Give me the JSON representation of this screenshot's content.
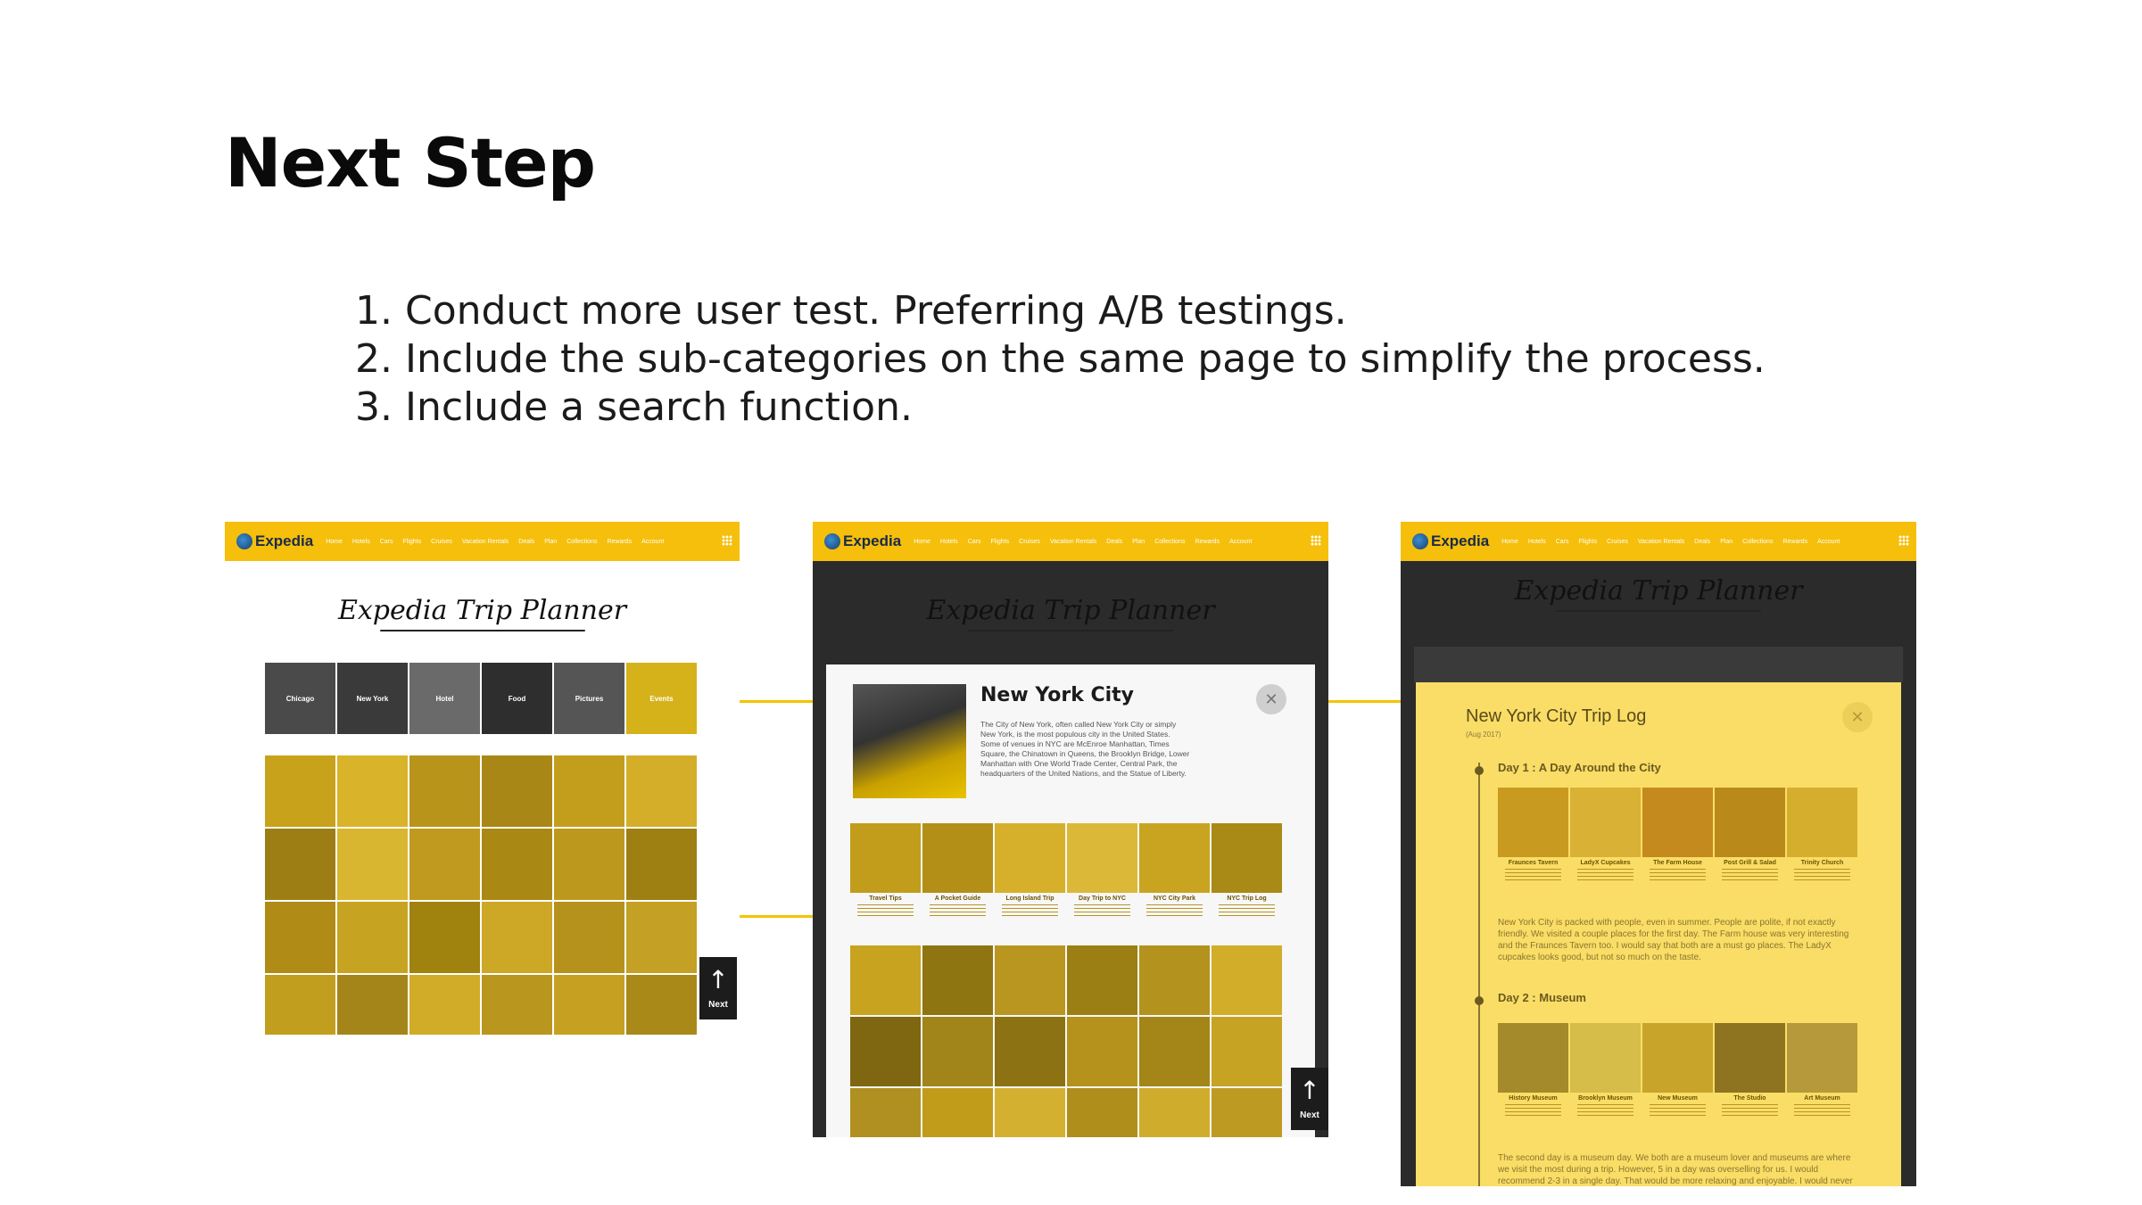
{
  "slide": {
    "title": "Next Step",
    "steps": [
      "1. Conduct more user test. Preferring A/B testings.",
      "2. Include the sub-categories on the same page to simplify the process.",
      "3. Include a search function."
    ]
  },
  "header": {
    "brand": "Expedia",
    "nav": [
      "Home",
      "Hotels",
      "Cars",
      "Flights",
      "Cruises",
      "Vacation Rentals",
      "Deals",
      "Plan",
      "Collections",
      "Rewards",
      "Account"
    ]
  },
  "planner_title": "Expedia Trip Planner",
  "categories": [
    "Chicago",
    "New York",
    "Hotel",
    "Food",
    "Pictures",
    "Events"
  ],
  "scroll_button": {
    "label": "Next"
  },
  "city_modal": {
    "title": "New York City",
    "description": "The City of New York, often called New York City or simply New York, is the most populous city in the United States. Some of venues in NYC are McEnroe Manhattan, Times Square, the Chinatown in Queens, the Brooklyn Bridge, Lower Manhattan with One World Trade Center, Central Park, the headquarters of the United Nations, and the Statue of Liberty.",
    "close_icon": "close-icon",
    "cards": [
      "Travel Tips",
      "A Pocket Guide",
      "Long Island Trip",
      "Day Trip to NYC",
      "NYC City Park",
      "NYC Trip Log"
    ]
  },
  "trip_log": {
    "title": "New York City Trip Log",
    "date": "(Aug 2017)",
    "day1": {
      "heading": "Day 1 : A Day Around the City",
      "places": [
        "Fraunces Tavern",
        "LadyX Cupcakes",
        "The Farm House",
        "Post Grill & Salad",
        "Trinity Church"
      ],
      "text": "New York City is packed with people, even in summer. People are polite, if not exactly friendly. We visited a couple places for the first day. The Farm house was very interesting and the Fraunces Tavern too. I would say that both are a must go places. The LadyX cupcakes looks good, but not so much on the taste."
    },
    "day2": {
      "heading": "Day 2 : Museum",
      "places": [
        "History Museum",
        "Brooklyn Museum",
        "New Museum",
        "The Studio",
        "Art Museum"
      ],
      "text": "The second day is a museum day. We both are a museum lover and museums are where we visit the most during a trip. However, 5 in a day was overselling for us. I would recommend 2-3 in a single day. That would be more relaxing and enjoyable. I would never plan that much again. But also the city has several arts."
    }
  },
  "colors": {
    "brand_yellow": "#f5bf0b",
    "overlay_yellow": "#f9dd66",
    "dark_bg": "#2b2b2b"
  }
}
